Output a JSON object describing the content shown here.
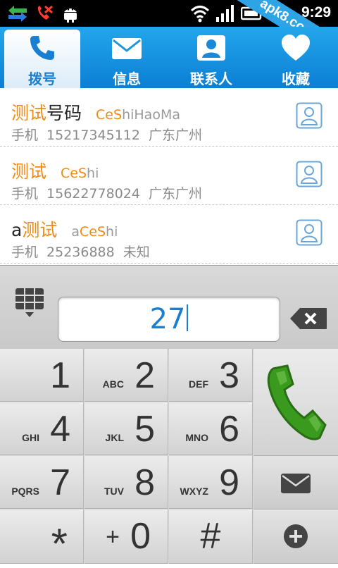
{
  "status_bar": {
    "time": "9:29",
    "watermark": "apk8.com",
    "icons": [
      "usb-transfer-icon",
      "missed-call-icon",
      "android-icon",
      "wifi-icon",
      "signal-icon",
      "battery-icon"
    ]
  },
  "tabs": [
    {
      "label": "拨号",
      "icon": "phone-icon",
      "active": true
    },
    {
      "label": "信息",
      "icon": "envelope-icon",
      "active": false
    },
    {
      "label": "联系人",
      "icon": "contact-card-icon",
      "active": false
    },
    {
      "label": "收藏",
      "icon": "heart-icon",
      "active": false
    }
  ],
  "contacts": [
    {
      "name_hl": "测试",
      "name_rest": "号码",
      "pinyin_pre": "",
      "pinyin_hl": "CeS",
      "pinyin_rest": "hiHaoMa",
      "phone_type": "手机",
      "phone": "15217345112",
      "location": "广东广州"
    },
    {
      "name_pre": "",
      "name_hl": "测试",
      "name_rest": "",
      "pinyin_pre": "",
      "pinyin_hl": "CeS",
      "pinyin_rest": "hi",
      "phone_type": "手机",
      "phone": "15622778024",
      "location": "广东广州"
    },
    {
      "name_pre": "a",
      "name_hl": "测试",
      "name_rest": "",
      "pinyin_pre": "a",
      "pinyin_hl": "CeS",
      "pinyin_rest": "hi",
      "phone_type": "手机",
      "phone": "25236888",
      "location": "未知"
    }
  ],
  "dialer": {
    "input_value": "27",
    "keys": [
      {
        "digit": "1",
        "letters": ""
      },
      {
        "digit": "2",
        "letters": "ABC"
      },
      {
        "digit": "3",
        "letters": "DEF"
      },
      {
        "digit": "4",
        "letters": "GHI"
      },
      {
        "digit": "5",
        "letters": "JKL"
      },
      {
        "digit": "6",
        "letters": "MNO"
      },
      {
        "digit": "7",
        "letters": "PQRS"
      },
      {
        "digit": "8",
        "letters": "TUV"
      },
      {
        "digit": "9",
        "letters": "WXYZ"
      },
      {
        "digit": "*",
        "letters": ""
      },
      {
        "digit": "0",
        "letters": "+"
      },
      {
        "digit": "#",
        "letters": ""
      }
    ]
  },
  "colors": {
    "tab_bar": "#1a95e2",
    "highlight": "#f18a12",
    "number": "#1a7fd0",
    "call_green": "#3a9a1e"
  }
}
